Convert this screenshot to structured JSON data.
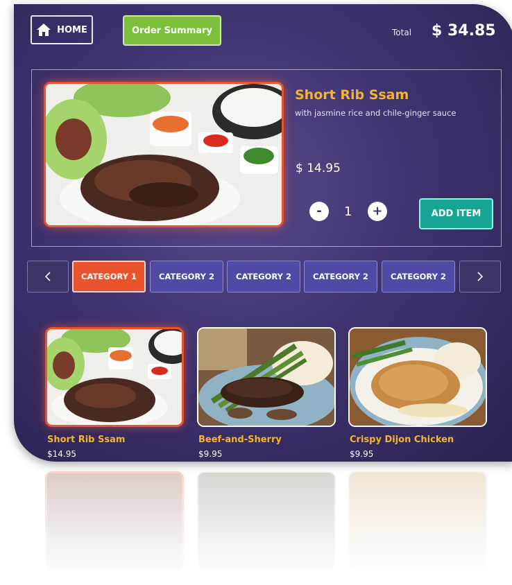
{
  "header": {
    "home_label": "HOME",
    "order_summary_label": "Order Summary",
    "total_label": "Total",
    "total_value": "$ 34.85"
  },
  "featured": {
    "title": "Short Rib Ssam",
    "subtitle": "with jasmine rice and chile-ginger sauce",
    "price": "$ 14.95",
    "quantity": "1",
    "minus_label": "-",
    "plus_label": "+",
    "add_label": "ADD ITEM"
  },
  "categories": {
    "prev_icon": "chevron-left-icon",
    "next_icon": "chevron-right-icon",
    "items": [
      {
        "label": "CATEGORY 1",
        "active": true
      },
      {
        "label": "CATEGORY 2",
        "active": false
      },
      {
        "label": "CATEGORY 2",
        "active": false
      },
      {
        "label": "CATEGORY 2",
        "active": false
      },
      {
        "label": "CATEGORY 2",
        "active": false
      }
    ]
  },
  "menu": {
    "items": [
      {
        "name": "Short Rib Ssam",
        "price": "$14.95"
      },
      {
        "name": "Beef-and-Sherry",
        "price": "$9.95"
      },
      {
        "name": "Crispy Dijon Chicken",
        "price": "$9.95"
      }
    ]
  },
  "colors": {
    "accent_orange": "#e9542f",
    "title_gold": "#f7b32b",
    "order_green": "#7bbf3a",
    "add_teal": "#16a495",
    "category_purple": "#4f4aa3",
    "background": "#3f3370"
  }
}
